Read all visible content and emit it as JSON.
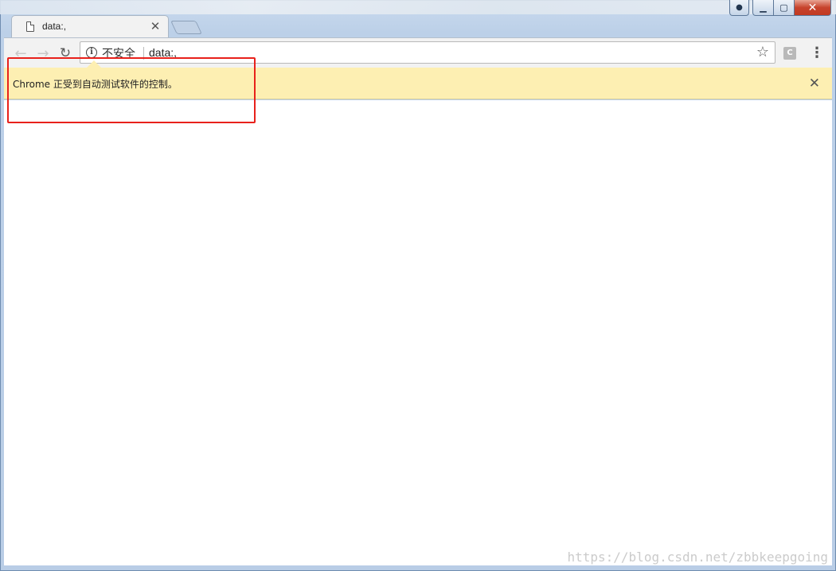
{
  "tab": {
    "title": "data:,",
    "close_glyph": "✕"
  },
  "toolbar": {
    "back_glyph": "←",
    "forward_glyph": "→",
    "reload_glyph": "↻",
    "extension_letter": "C",
    "menu_glyph": "⋮"
  },
  "omnibox": {
    "security_label": "不安全",
    "url": "data:,",
    "star_glyph": "☆",
    "info_glyph": "i"
  },
  "infobar": {
    "message": "Chrome 正受到自动测试软件的控制。",
    "close_glyph": "✕"
  },
  "window": {
    "close_glyph": "✕",
    "min_glyph": "▁",
    "max_glyph": "▢",
    "user_glyph": "👤"
  },
  "watermark": "https://blog.csdn.net/zbbkeepgoing",
  "colors": {
    "infobar_bg": "#fdefb2",
    "annotation": "#e8211b"
  }
}
